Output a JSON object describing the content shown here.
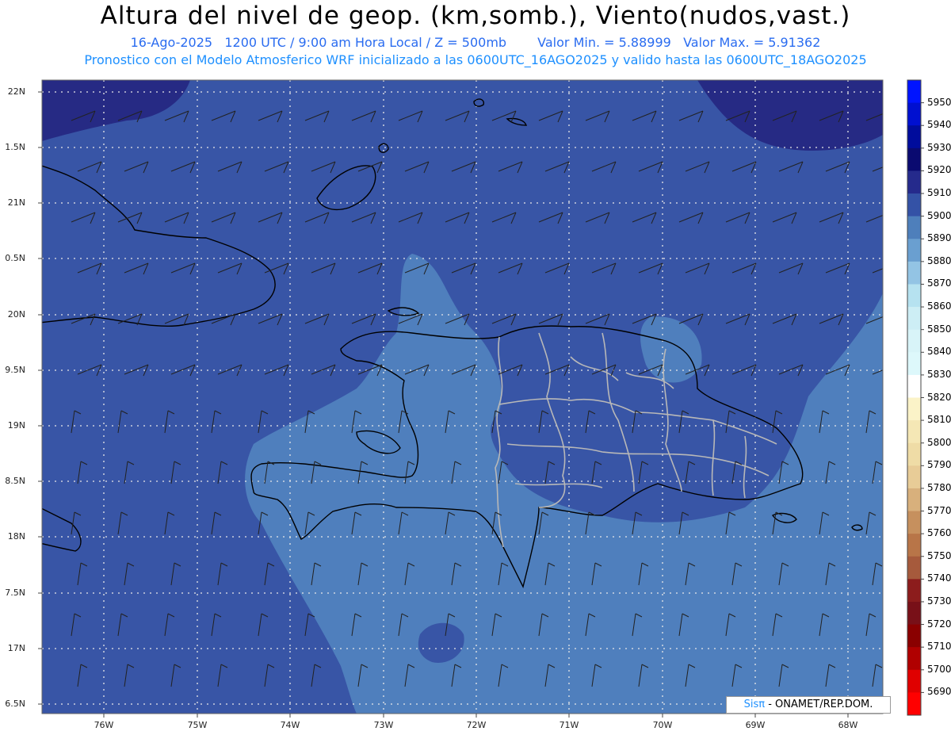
{
  "title": "Altura del nivel de geop. (km,somb.), Viento(nudos,vast.)",
  "subtitle": {
    "date": "16-Ago-2025",
    "time": "1200 UTC / 9:00 am Hora Local / Z = 500mb",
    "min": "Valor Min. = 5.88999",
    "max": "Valor Max. = 5.91362"
  },
  "info_line": "Pronostico con el Modelo Atmosferico WRF inicializado a las 0600UTC_16AGO2025 y valido hasta las  0600UTC_18AGO2025",
  "lat_labels": [
    "22N",
    "1.5N",
    "21N",
    "0.5N",
    "20N",
    "9.5N",
    "19N",
    "8.5N",
    "18N",
    "7.5N",
    "17N",
    "6.5N"
  ],
  "lon_labels": [
    "76W",
    "75W",
    "74W",
    "73W",
    "72W",
    "71W",
    "70W",
    "69W",
    "68W"
  ],
  "credit": {
    "sis": "Sisπ",
    "rest": " - ONAMET/REP.DOM."
  },
  "colorbar": {
    "labels": [
      "5950",
      "5940",
      "5930",
      "5920",
      "5910",
      "5900",
      "5890",
      "5880",
      "5870",
      "5860",
      "5850",
      "5840",
      "5830",
      "5820",
      "5810",
      "5800",
      "5790",
      "5780",
      "5770",
      "5760",
      "5750",
      "5740",
      "5730",
      "5720",
      "5710",
      "5700",
      "5690"
    ],
    "colors": [
      "#0014ff",
      "#0010d0",
      "#000c9c",
      "#0a0a70",
      "#252a8c",
      "#3452a6",
      "#4e7fbb",
      "#6a9fd0",
      "#93c4e4",
      "#b6e2f0",
      "#cdeef5",
      "#d8f4f8",
      "#ddf8fb",
      "#ffffff",
      "#fbf3c8",
      "#f5e7b5",
      "#efdca6",
      "#e8cc97",
      "#d8b07c",
      "#c6905e",
      "#b87548",
      "#a65a3c",
      "#8c1c1c",
      "#781018",
      "#8a0000",
      "#b00000",
      "#e00000",
      "#ff0000"
    ]
  },
  "legend_colors": {
    "dark_band": "#262a84",
    "main_field": "#3855a6",
    "light_field": "#4f7fbd",
    "lightest_field": "#6b9fd2",
    "coast": "#000000",
    "provinces": "#b8b8b8",
    "grid": "#e8e8e8"
  }
}
